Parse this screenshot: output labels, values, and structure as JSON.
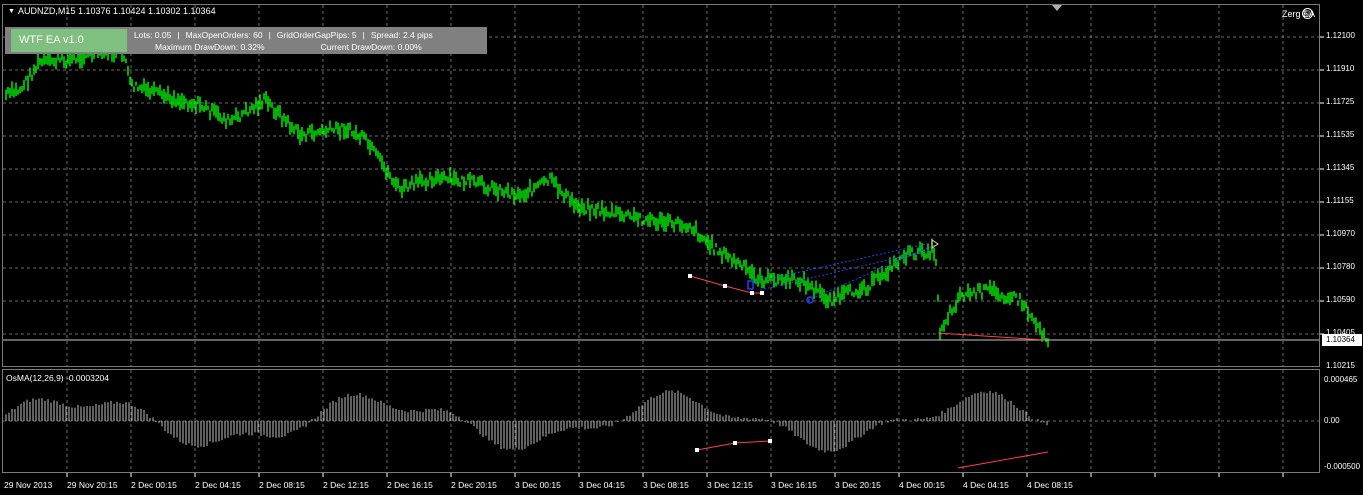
{
  "header": {
    "symbol_line": "AUDNZD,M15  1.10376 1.10424 1.10302 1.10364",
    "ea_name": "Zerg EA"
  },
  "info_panel": {
    "ea_badge": "WTF EA v1.0",
    "line1": [
      "Lots: 0.05",
      "MaxOpenOrders: 60",
      "GridOrderGapPips: 5",
      "Spread: 2.4 pips"
    ],
    "max_drawdown": "Maximum DrawDown: 0.32%",
    "current_drawdown": "Current DrawDown: 0.00%"
  },
  "price_axis": [
    "1.12100",
    "1.11910",
    "1.11725",
    "1.11535",
    "1.11345",
    "1.11155",
    "1.10970",
    "1.10780",
    "1.10590",
    "1.10405",
    "1.10215"
  ],
  "current_price": "1.10364",
  "osma": {
    "title": "OsMA(12,26,9) -0.0003204",
    "axis": [
      "0.000465",
      "0.00",
      "-0.000500"
    ]
  },
  "time_axis": [
    "29 Nov 2013",
    "29 Nov 20:15",
    "2 Dec 00:15",
    "2 Dec 04:15",
    "2 Dec 08:15",
    "2 Dec 12:15",
    "2 Dec 16:15",
    "2 Dec 20:15",
    "3 Dec 00:15",
    "3 Dec 04:15",
    "3 Dec 08:15",
    "3 Dec 12:15",
    "3 Dec 16:15",
    "3 Dec 20:15",
    "4 Dec 00:15",
    "4 Dec 04:15",
    "4 Dec 08:15"
  ],
  "colors": {
    "background": "#000000",
    "candle": "#00ff00",
    "grid": "#6a6a6a",
    "histogram": "#c0c0c0",
    "divergence": "#ff4040",
    "order_line": "#2040ff",
    "info_panel": "#808080",
    "ea_badge": "#7fbf7f"
  },
  "icons": {
    "dropdown": "triangle-down-icon",
    "status": "smiley-icon",
    "scroll": "scroll-marker-icon"
  }
}
